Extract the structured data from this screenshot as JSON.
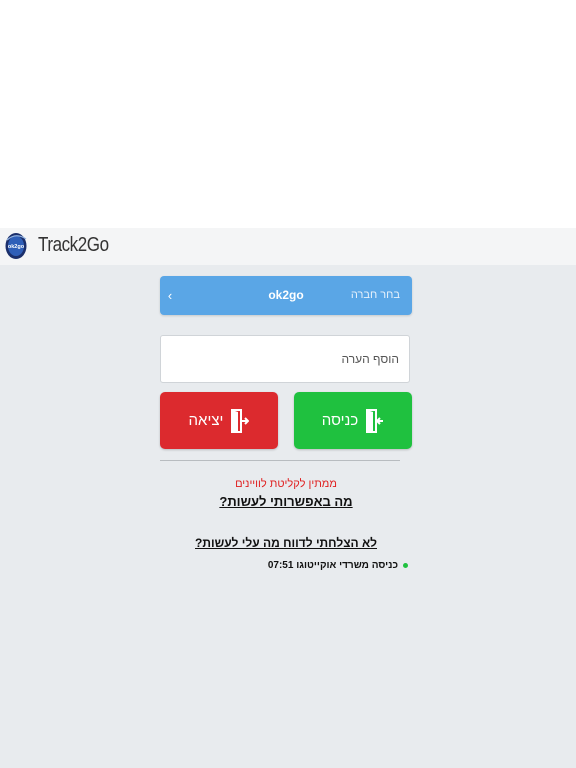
{
  "header": {
    "brand": "Track2Go",
    "logo_text": "ok2go"
  },
  "company_select": {
    "label": "בחר חברה",
    "value": "ok2go",
    "chevron": "‹"
  },
  "note_input": {
    "placeholder": "הוסף הערה",
    "value": ""
  },
  "buttons": {
    "enter_label": "כניסה",
    "exit_label": "יציאה",
    "enter_icon": "door-enter-icon",
    "exit_icon": "door-exit-icon"
  },
  "status": {
    "text": "ממתין לקליטת לוויינים"
  },
  "links": {
    "options": "מה באפשרותי לעשות?",
    "report_failed": "לא הצלחתי לדווח מה עלי לעשות?"
  },
  "log": [
    {
      "text": "כניסה משרדי אוקייטוגו 07:51"
    }
  ],
  "colors": {
    "primary_blue": "#5aa6e6",
    "enter_green": "#1fc13f",
    "exit_red": "#dc2a2e",
    "status_red": "#e02020",
    "background": "#e8ebee"
  }
}
